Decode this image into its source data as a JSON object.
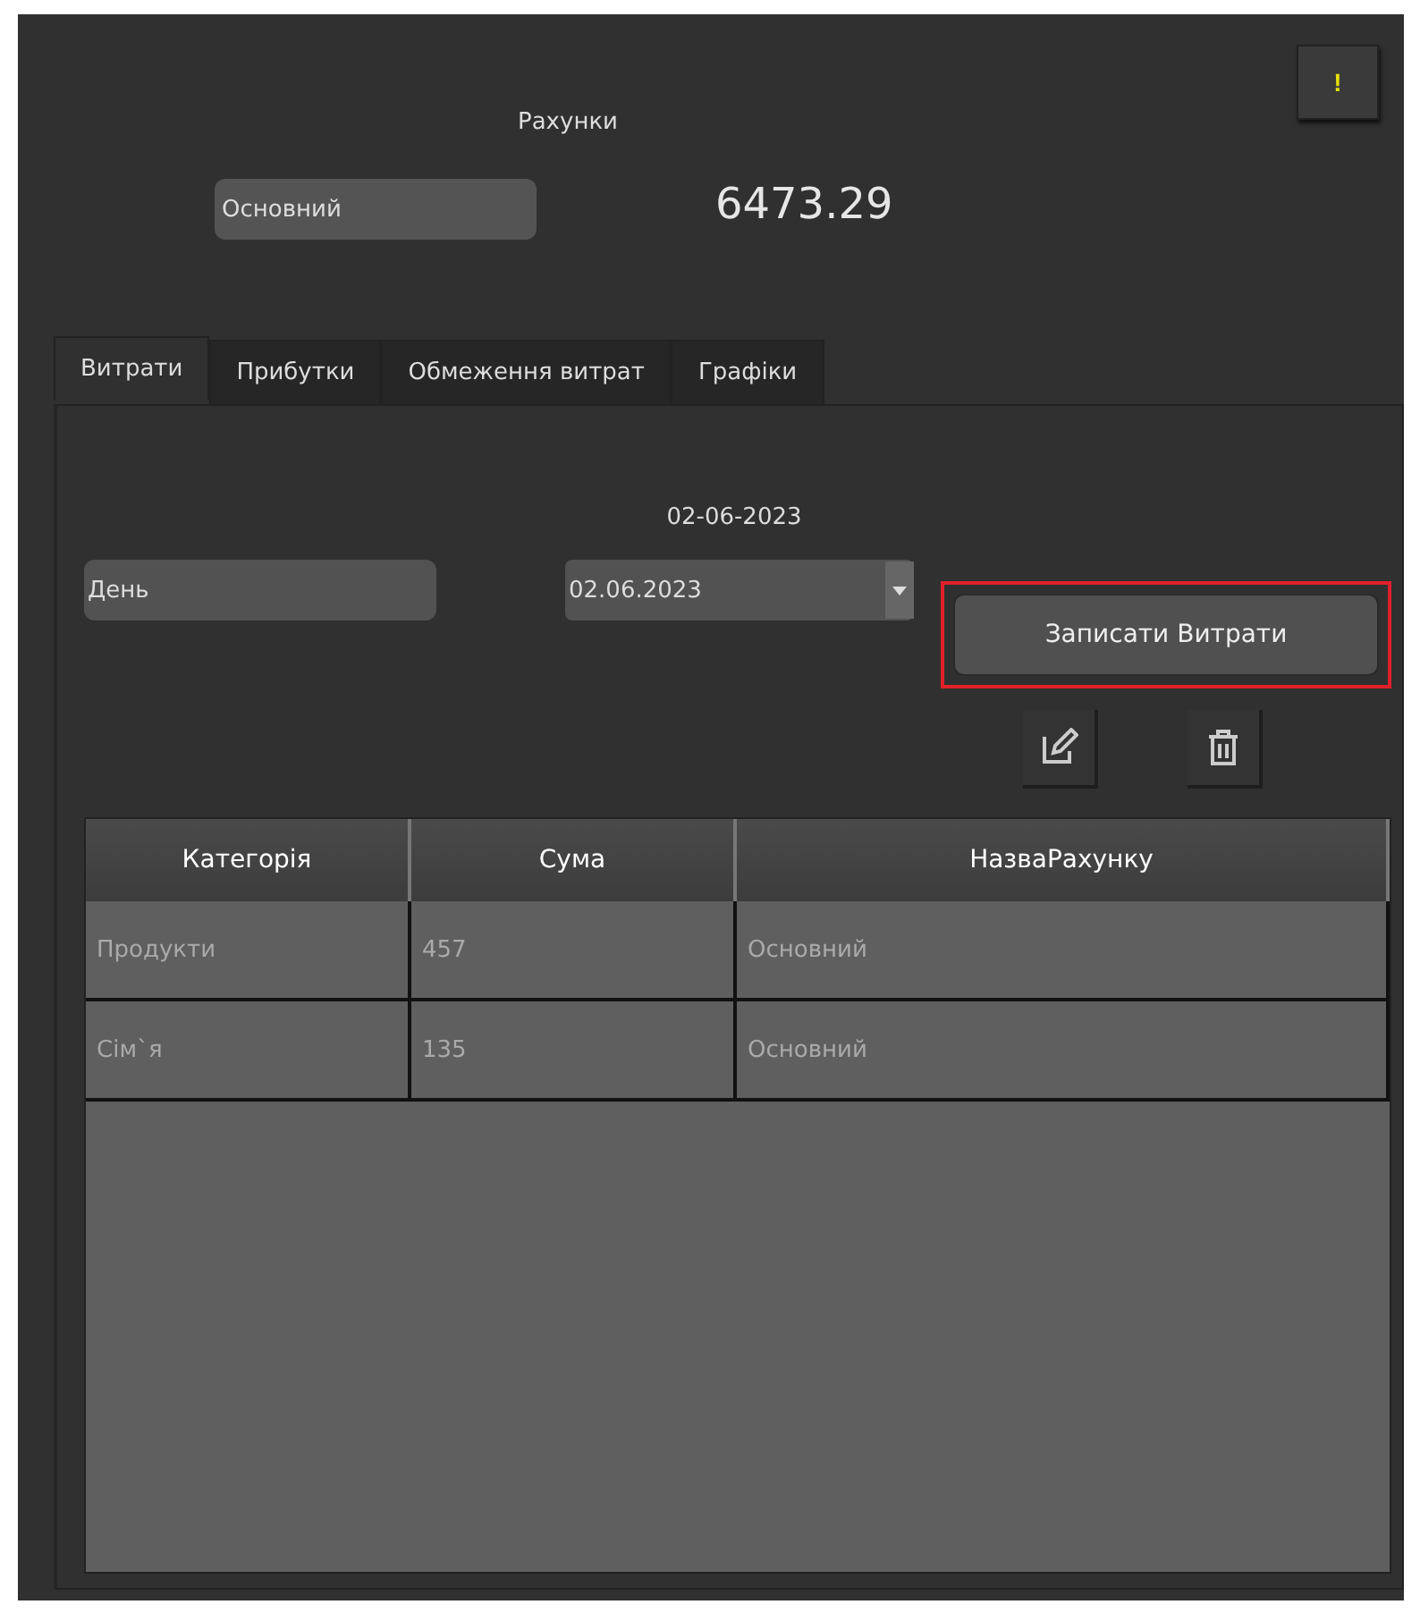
{
  "title": "Рахунки",
  "alert_button": {
    "label": "!"
  },
  "account_select": {
    "value": "Основний"
  },
  "balance": "6473.29",
  "tabs": [
    {
      "label": "Витрати",
      "selected": true
    },
    {
      "label": "Прибутки",
      "selected": false
    },
    {
      "label": "Обмеження витрат",
      "selected": false
    },
    {
      "label": "Графіки",
      "selected": false
    }
  ],
  "date_label": "02-06-2023",
  "period_field": {
    "value": "День"
  },
  "date_field": {
    "value": "02.06.2023"
  },
  "save_button": {
    "label": "Записати Витрати",
    "highlighted": true
  },
  "table": {
    "columns": [
      "Категорія",
      "Сума",
      "НазваРахунку"
    ],
    "rows": [
      [
        "Продукти",
        "457",
        "Основний"
      ],
      [
        "Сім`я",
        "135",
        "Основний"
      ]
    ]
  }
}
